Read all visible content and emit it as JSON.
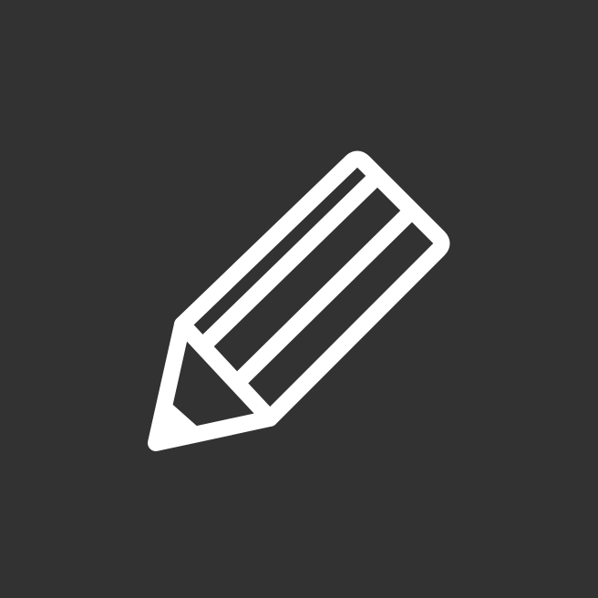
{
  "edit_button": {
    "icon": "pencil-icon",
    "background_color": "#323232",
    "icon_color": "#ffffff"
  }
}
